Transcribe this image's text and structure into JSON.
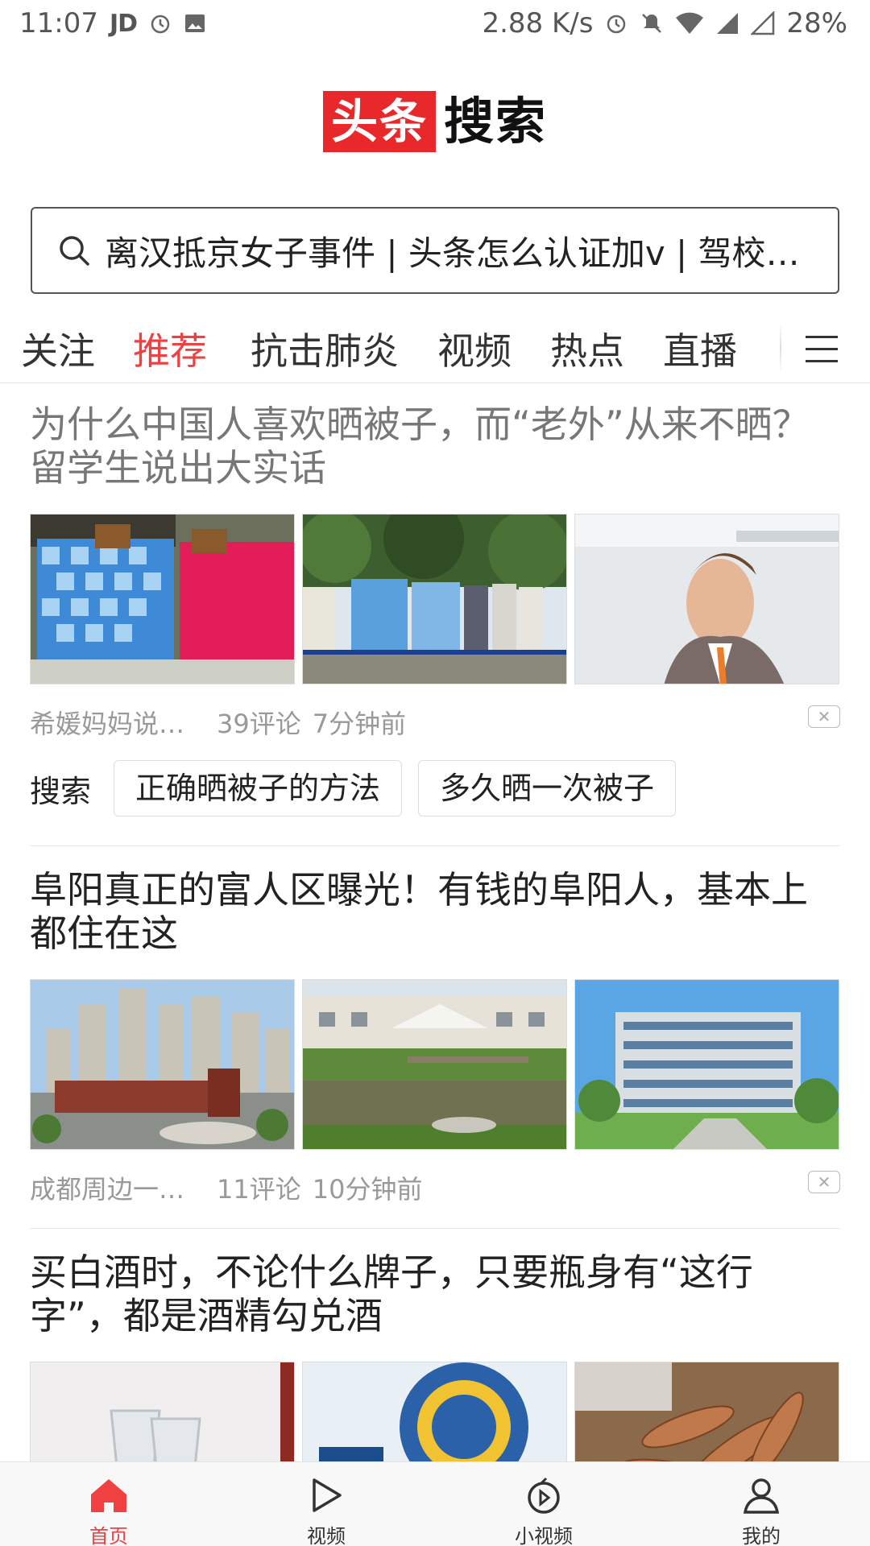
{
  "status_bar": {
    "time": "11:07",
    "app_badge": "JD",
    "net_speed": "2.88 K/s",
    "battery": "28%"
  },
  "logo": {
    "red_part": "头条",
    "black_part": "搜索"
  },
  "search": {
    "text": "离汉抵京女子事件 | 头条怎么认证加v | 驾校学..."
  },
  "tabs": [
    {
      "label": "关注"
    },
    {
      "label": "推荐",
      "active": true
    },
    {
      "label": "抗击肺炎"
    },
    {
      "label": "视频"
    },
    {
      "label": "热点"
    },
    {
      "label": "直播"
    }
  ],
  "articles": [
    {
      "title": "为什么中国人喜欢晒被子，而“老外”从来不晒？留学生说出大实话",
      "source": "希媛妈妈说育儿",
      "comments": "39评论",
      "time": "7分钟前",
      "related_label": "搜索",
      "related": [
        "正确晒被子的方法",
        "多久晒一次被子"
      ]
    },
    {
      "title": "阜阳真正的富人区曝光！有钱的阜阳人，基本上都住在这",
      "source": "成都周边一点通",
      "comments": "11评论",
      "time": "10分钟前"
    },
    {
      "title": "买白酒时，不论什么牌子，只要瓶身有“这行字”，都是酒精勾兑酒"
    }
  ],
  "bottom_nav": [
    {
      "label": "首页",
      "icon": "home-icon",
      "active": true
    },
    {
      "label": "视频",
      "icon": "video-icon"
    },
    {
      "label": "小视频",
      "icon": "short-video-icon"
    },
    {
      "label": "我的",
      "icon": "profile-icon"
    }
  ],
  "colors": {
    "accent": "#f04142",
    "logo_red": "#e8282b"
  }
}
